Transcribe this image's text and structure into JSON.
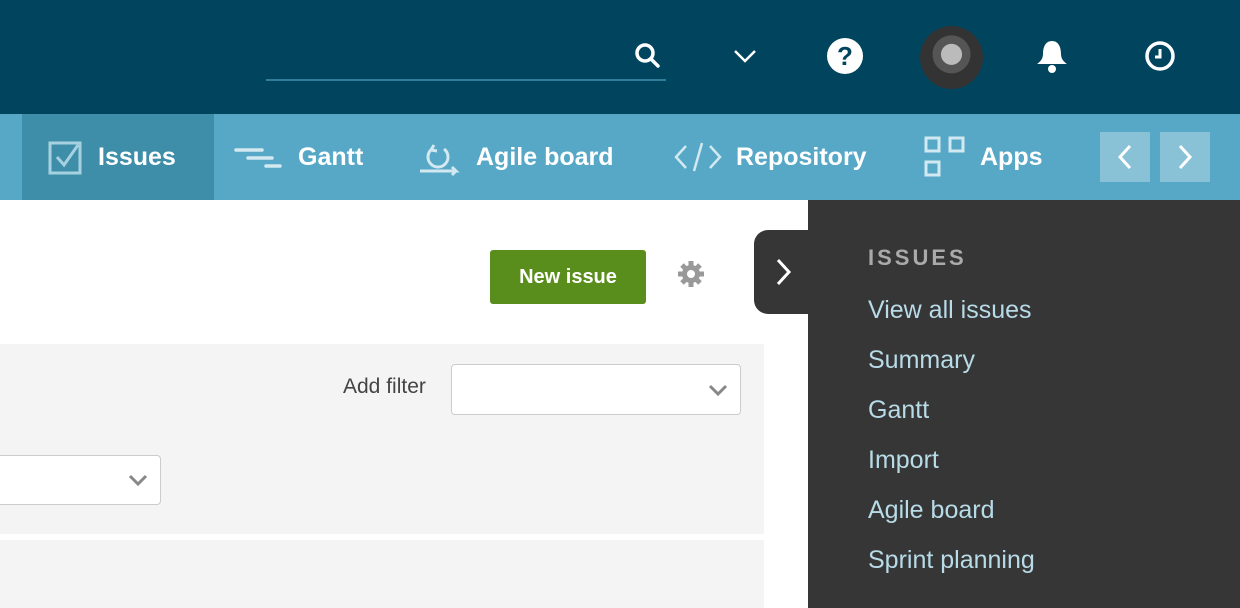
{
  "header": {
    "search_placeholder": "",
    "icons": [
      "search-icon",
      "chevron-down-icon",
      "help-icon",
      "avatar",
      "bell-icon",
      "clock-icon"
    ]
  },
  "nav": {
    "tabs": [
      {
        "label": "Issues",
        "icon": "checkbox-icon",
        "active": true
      },
      {
        "label": "Gantt",
        "icon": "gantt-icon"
      },
      {
        "label": "Agile board",
        "icon": "cycle-icon"
      },
      {
        "label": "Repository",
        "icon": "code-icon"
      },
      {
        "label": "Apps",
        "icon": "apps-grid-icon"
      }
    ]
  },
  "toolbar": {
    "new_issue": "New issue"
  },
  "filters": {
    "add_filter_label": "Add filter",
    "add_filter_value": ""
  },
  "sidebar": {
    "title": "ISSUES",
    "items": [
      "View all issues",
      "Summary",
      "Gantt",
      "Import",
      "Agile board",
      "Sprint planning"
    ]
  },
  "colors": {
    "header": "#00445e",
    "nav": "#56a8c6",
    "nav_active": "#3e8ea9",
    "primary_button": "#5a8e1c",
    "sidebar": "#363636",
    "sidebar_link": "#b8dbe8"
  }
}
